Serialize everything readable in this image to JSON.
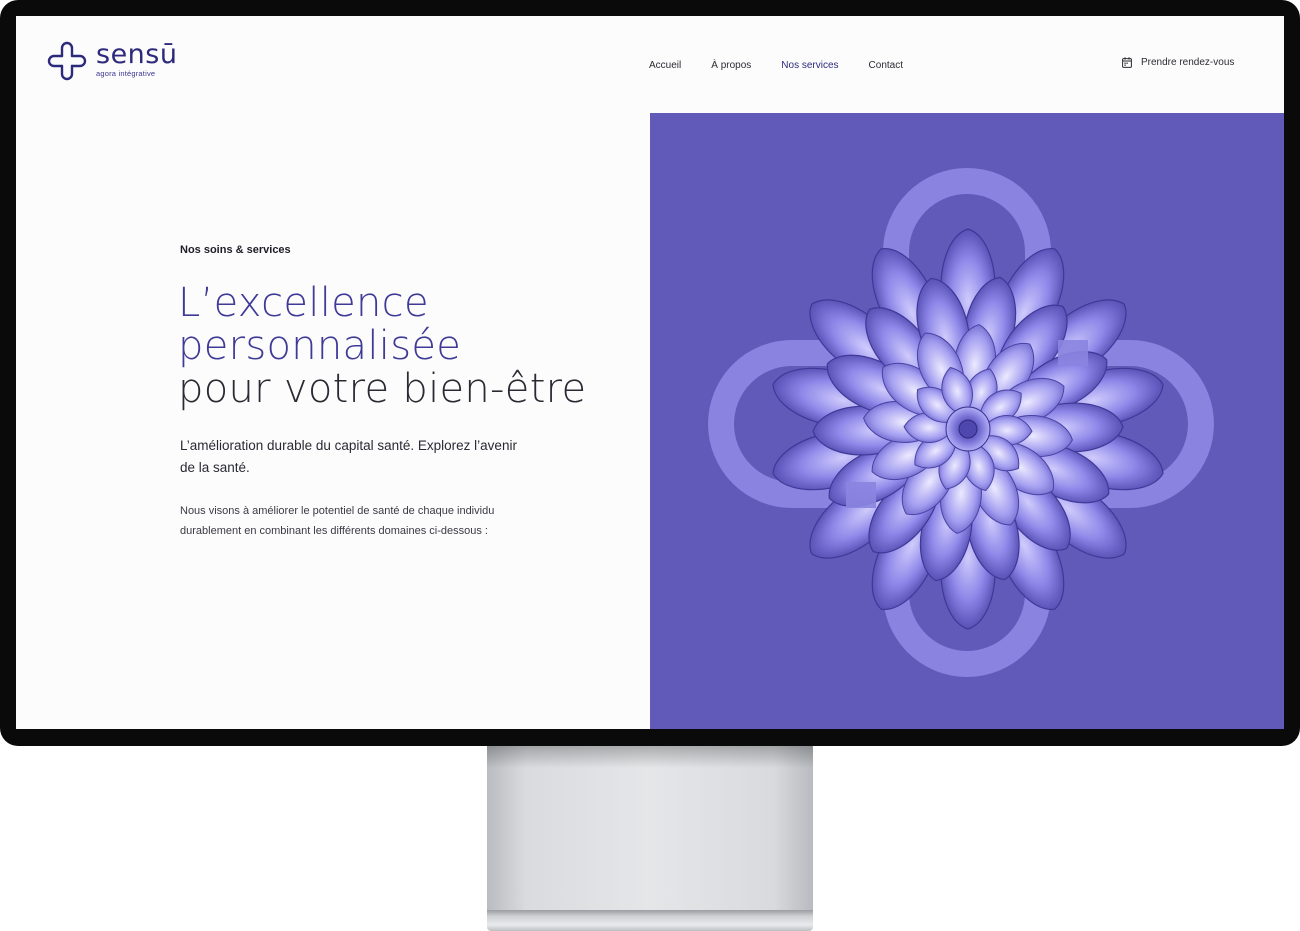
{
  "brand": {
    "name": "sensū",
    "tagline": "agora intégrative",
    "color_primary": "#2d2a7c",
    "color_panel": "#615ab9",
    "color_loop": "#8a84e0",
    "logo_icon": "clover-loop-icon"
  },
  "nav": {
    "items": [
      {
        "label": "Accueil",
        "active": false
      },
      {
        "label": "À propos",
        "active": false
      },
      {
        "label": "Nos services",
        "active": true
      },
      {
        "label": "Contact",
        "active": false
      }
    ]
  },
  "cta": {
    "label": "Prendre rendez-vous",
    "icon": "calendar-icon"
  },
  "hero": {
    "eyebrow": "Nos soins & services",
    "title_lines": [
      "L’excellence",
      "personnalisée",
      "pour votre bien-être"
    ],
    "lead": "L’amélioration durable du capital santé. Explorez l’avenir de la santé.",
    "body": "Nous visons à améliorer le potentiel de santé de chaque individu durablement en combinant les différents domaines ci-dessous :"
  },
  "visual": {
    "subject": "succulent-flower-image",
    "overlay": "clover-loop-shape"
  }
}
